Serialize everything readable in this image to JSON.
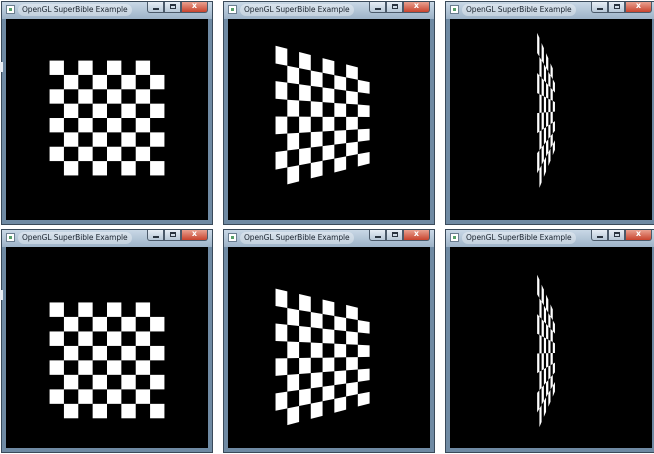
{
  "windows": [
    {
      "id": "top-left",
      "title": "OpenGL SuperBible Example"
    },
    {
      "id": "top-middle",
      "title": "OpenGL SuperBible Example"
    },
    {
      "id": "top-right",
      "title": "OpenGL SuperBible Example"
    },
    {
      "id": "bottom-left",
      "title": "OpenGL SuperBible Example"
    },
    {
      "id": "bottom-middle",
      "title": "OpenGL SuperBible Example"
    },
    {
      "id": "bottom-right",
      "title": "OpenGL SuperBible Example"
    }
  ],
  "controls": {
    "minimize": "",
    "maximize": "",
    "close": "x"
  },
  "colors": {
    "checker_light": "#ffffff",
    "checker_dark": "#000000",
    "viewport": "#000000"
  }
}
